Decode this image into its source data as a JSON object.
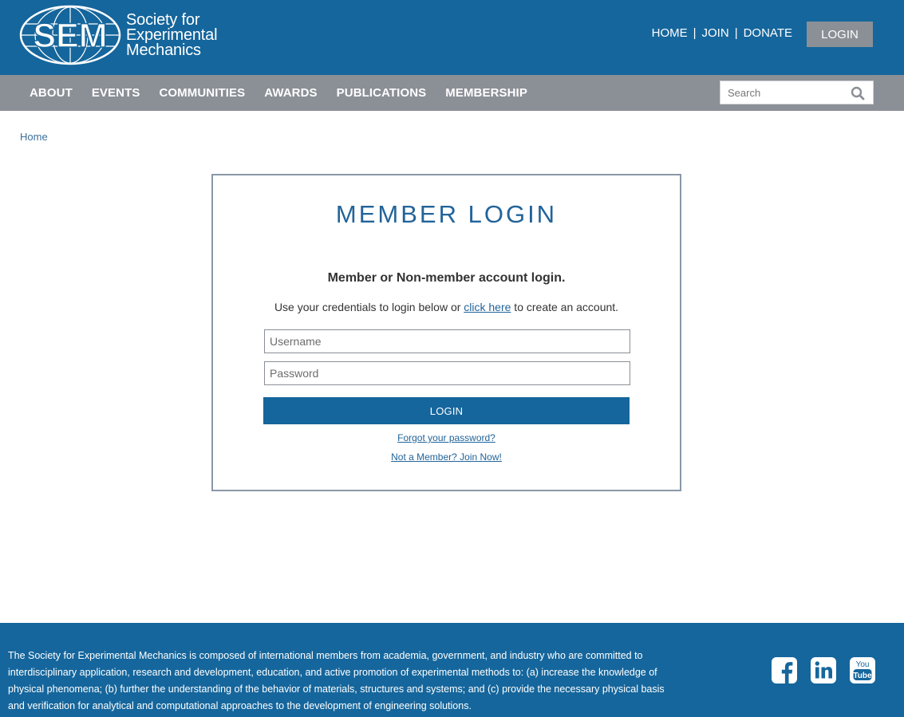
{
  "header": {
    "logo_mark": "SEM",
    "logo_lines": [
      "Society for",
      "Experimental",
      "Mechanics"
    ],
    "links": [
      "HOME",
      "JOIN",
      "DONATE"
    ],
    "separator": "|",
    "login_label": "LOGIN"
  },
  "nav": {
    "items": [
      "ABOUT",
      "EVENTS",
      "COMMUNITIES",
      "AWARDS",
      "PUBLICATIONS",
      "MEMBERSHIP"
    ],
    "search_placeholder": "Search"
  },
  "breadcrumb": "Home",
  "login": {
    "title": "MEMBER LOGIN",
    "subtitle": "Member or Non-member account login.",
    "desc_before": "Use your credentials to login below or ",
    "desc_link": "click here",
    "desc_after": " to create an account.",
    "username_placeholder": "Username",
    "password_placeholder": "Password",
    "submit_label": "LOGIN",
    "forgot_link": "Forgot your password?",
    "join_link": "Not a Member? Join Now!"
  },
  "footer": {
    "text": "The Society for Experimental Mechanics is composed of international members from academia, government, and industry who are committed to interdisciplinary application, research and development, education, and active promotion of experimental methods to: (a) increase the knowledge of physical phenomena; (b) further the understanding of the behavior of materials, structures and systems; and (c) provide the necessary physical basis and verification for analytical and computational approaches to the development of engineering solutions.",
    "social_icons": [
      "facebook-icon",
      "linkedin-icon",
      "youtube-icon"
    ],
    "youtube_lines": [
      "You",
      "Tube"
    ]
  },
  "colors": {
    "brand_blue": "#15669c",
    "nav_gray": "#8b8f96",
    "title_blue": "#22649a"
  }
}
